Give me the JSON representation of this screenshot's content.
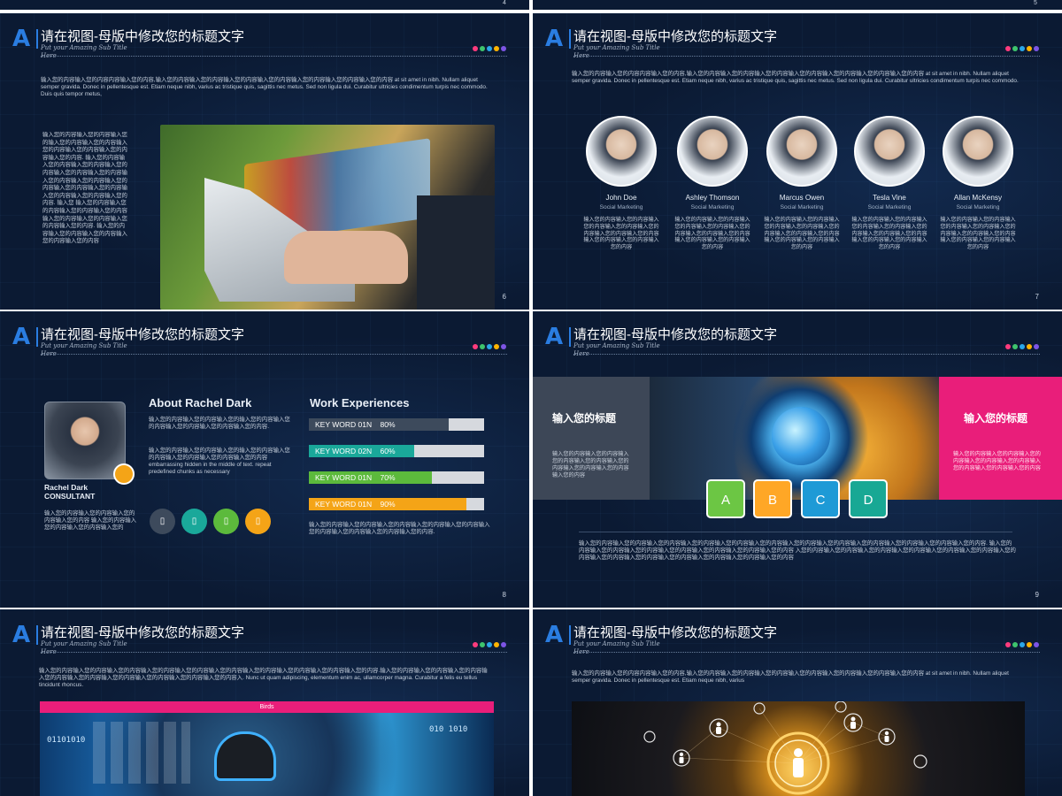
{
  "top": {
    "num_left": "4",
    "num_right": "5"
  },
  "common": {
    "title": "请在视图-母版中修改您的标题文字",
    "subtitle": "Put your Amazing Sub Title Here",
    "dot_colors": [
      "#ff3b7d",
      "#3ec46d",
      "#2aa6e8",
      "#ffb400",
      "#7d55e5"
    ]
  },
  "slide6": {
    "page": "6",
    "intro": "输入您的内容输入您的内容内容输入您的内容,输入您的内容输入您的内容输入您的内容输入您的内容输入您的内容输入您的内容输入您的内容 at sit amet in nibh. Nullam aliquet semper gravida. Donec in pellentesque est. Etiam neque nibh, varius ac tristique quis, sagittis nec metus. Sed non ligula dui. Curabitur ultricies condimentum turpis nec commodo. Duis quis tempor metus,",
    "side": "输入您的内容输入您的内容输入您的输入您的内容输入您的内容输入您的内容输入您的内容输入您的内容输入您的内容. 输入您的内容输入您的内容输入您的内容输入您的内容输入您的内容输入您的内容输入您的内容输入您的内容输入您的内容输入您的内容输入您的内容输入您的内容输入您的内容输入您的内容. 输入您 输入您的内容输入您的内容输入您的内容输入您的内容输入您的内容输入您的内容输入您的内容输入您的内容. 输入您的内容输入您的内容输入您的内容输入您的内容输入您的内容"
  },
  "slide7": {
    "page": "7",
    "intro": "输入您的内容输入您的内容内容输入您的内容,输入您的内容输入您的内容输入您的内容输入您的内容输入您的内容输入您的内容输入您的内容 at sit amet in nibh. Nullam aliquet semper gravida. Donec in pellentesque est. Etiam neque nibh, varius ac tristique quis, sagittis nec metus. Sed non ligula dui. Curabitur ultricies condimentum turpis nec commodo.",
    "people": [
      {
        "name": "John Doe",
        "role": "Social Marketing",
        "desc": "输入您的内容输入您的内容输入您的内容输入您的内容输入您的内容输入您的内容输入您的内容输入您的内容输入您的内容输入您的内容"
      },
      {
        "name": "Ashley Thomson",
        "role": "Social Marketing",
        "desc": "输入您的内容输入您的内容输入您的内容输入您的内容输入您的内容输入您的内容输入您的内容输入您的内容输入您的内容输入您的内容"
      },
      {
        "name": "Marcus Owen",
        "role": "Social Marketing",
        "desc": "输入您的内容输入您的内容输入您的内容输入您的内容输入您的内容输入您的内容输入您的内容输入您的内容输入您的内容输入您的内容"
      },
      {
        "name": "Tesla Vine",
        "role": "Social Marketing",
        "desc": "输入您的内容输入您的内容输入您的内容输入您的内容输入您的内容输入您的内容输入您的内容输入您的内容输入您的内容输入您的内容"
      },
      {
        "name": "Allan McKensy",
        "role": "Social Marketing",
        "desc": "输入您的内容输入您的内容输入您的内容输入您的内容输入您的内容输入您的内容输入您的内容输入您的内容输入您的内容输入您的内容"
      }
    ]
  },
  "slide8": {
    "page": "8",
    "name": "Rachel Dark",
    "job": "CONSULTANT",
    "left_text": "输入您的内容输入您的内容输入您的内容输入您的内容 输入您的内容输入您的内容输入您的内容输入您的",
    "about_title": "About Rachel Dark",
    "about_p1": "输入您的内容输入您的内容输入您的输入您的内容输入您的内容输入您的内容输入您的内容输入您的内容.",
    "about_p2": "输入您的内容输入您的内容输入您的输入您的内容输入您的内容输入您的内容输入您的内容输入您的内容 embarrassing hidden in the middle of text. repeat predefined chunks as necessary",
    "work_title": "Work Experiences",
    "bars": [
      {
        "label": "KEY WORD 01N",
        "pct": "80%",
        "value": 0.8,
        "color": "#3d4a5c"
      },
      {
        "label": "KEY WORD 02N",
        "pct": "60%",
        "value": 0.6,
        "color": "#1aa89a"
      },
      {
        "label": "KEY WORD 01N",
        "pct": "70%",
        "value": 0.7,
        "color": "#5cba3c"
      },
      {
        "label": "KEY WORD 01N",
        "pct": "90%",
        "value": 0.9,
        "color": "#f4a417"
      }
    ],
    "work_text": "输入您的内容输入您的内容输入您的内容输入您的内容输入您的内容输入您的内容输入您的内容输入您的内容输入您的内容.",
    "circle_colors": [
      "#3d4a5c",
      "#1aa89a",
      "#5cba3c",
      "#f4a417"
    ]
  },
  "slide9": {
    "page": "9",
    "left_title": "输入您的标题",
    "left_text": "输入您的内容输入您的内容输入您的内容输入您的内容输入您的内容输入您的内容输入您的内容输入您的内容",
    "right_title": "输入您的标题",
    "right_text": "输入您的内容输入您的内容输入您的内容输入您的内容输入您的内容输入您的内容输入您的内容输入您的内容",
    "tiles": [
      {
        "letter": "A",
        "color": "#6cc644"
      },
      {
        "letter": "B",
        "color": "#ffa726"
      },
      {
        "letter": "C",
        "color": "#1e9ad6"
      },
      {
        "letter": "D",
        "color": "#18a894"
      }
    ],
    "bottom": "输入您的内容输入您的内容输入您的内容输入您的内容输入您的内容输入您的内容输入您的内容输入您的内容输入您的内容输入您的内容输入您的内容输入您的内容. 输入您的内容输入您的内容输入您的内容输入您的内容输入您的内容输入您的内容输入您的内容 入您的内容输入您的内容输入您的内容输入您的内容输入您的内容输入您的内容输入您的内容输入您的内容输入您的内容输入您的内容输入您的内容输入您的内容输入您的内容"
  },
  "slide10": {
    "intro": "输入您的内容输入您的内容输入您的内容输入您的内容输入您的内容输入您的内容输入您的内容输入您的内容输入您的内容输入您的内容.输入您的内容输入您的内容输入您的内容输入您的内容输入您的内容输入您的内容输入您的内容输入您的内容输入您的内容入. Nunc ut quam adipiscing, elementum enim ac, ullamcorper magna. Curabitur a felis eu tellus tincidunt rhoncus.",
    "banner": "Birds",
    "binary1": "01101010",
    "binary2": "010 1010"
  },
  "slide11": {
    "intro": "输入您的内容输入您的内容内容输入您的内容,输入您的内容输入您的内容输入您的内容输入您的内容输入您的内容输入您的内容输入您的内容 at sit amet in nibh. Nullam aliquet semper gravida. Donec in pellentesque est. Etiam neque nibh, varius"
  }
}
